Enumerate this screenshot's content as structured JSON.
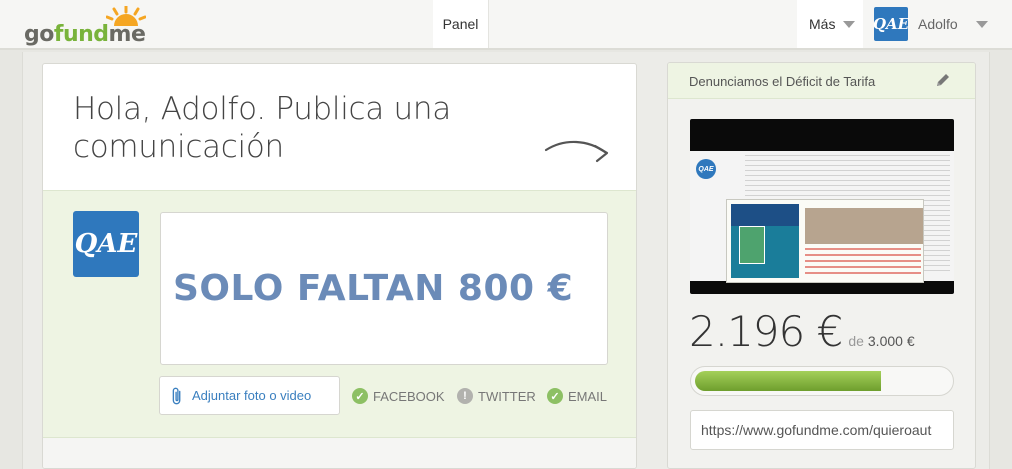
{
  "header": {
    "logo_text_a": "go",
    "logo_text_b": "fund",
    "logo_text_c": "me",
    "nav_panel": "Panel",
    "nav_more": "Más",
    "avatar_initials": "QAE",
    "user_name": "Adolfo"
  },
  "main": {
    "greeting": "Hola, Adolfo. Publica una comunicación",
    "avatar_initials": "QAE",
    "post_text": "SOLO FALTAN 800 €",
    "attach_label": "Adjuntar foto o video",
    "share": [
      {
        "label": "FACEBOOK",
        "checked": true
      },
      {
        "label": "TWITTER",
        "checked": false
      },
      {
        "label": "EMAIL",
        "checked": true
      }
    ]
  },
  "campaign": {
    "title": "Denunciamos el Déficit de Tarifa",
    "raised": "2.196 €",
    "of_label": "de",
    "goal": "3.000 €",
    "progress_fraction": 0.732,
    "url": "https://www.gofundme.com/quieroaut",
    "video_logo": "QAE"
  },
  "colors": {
    "brand_green": "#79b33b",
    "avatar_blue": "#2f78bd",
    "post_text": "#6b8bb8",
    "link_blue": "#3a7fbf"
  },
  "icons": {
    "logo": "sun-icon",
    "caret": "chevron-down-icon",
    "arrow": "curved-arrow-icon",
    "attach": "paperclip-icon",
    "check": "check-circle-icon",
    "alert": "exclamation-circle-icon",
    "edit": "pencil-icon"
  }
}
